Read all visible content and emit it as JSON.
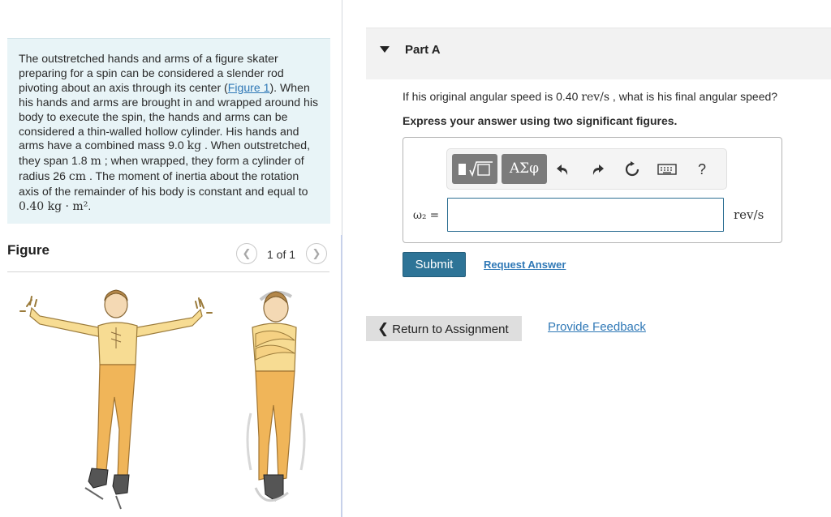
{
  "problem": {
    "text_before_link": "The outstretched hands and arms of a figure skater preparing for a spin can be considered a slender rod pivoting about an axis through its center (",
    "figure_link": "Figure 1",
    "text_after_link": "). When his hands and arms are brought in and wrapped around his body to execute the spin, the hands and arms can be considered a thin-walled hollow cylinder. His hands and arms have a combined mass 9.0 ",
    "mass_unit": "kg",
    "text_span": " . When outstretched, they span 1.8 ",
    "span_unit": "m",
    "text_radius": " ; when wrapped, they form a cylinder of radius 26 ",
    "radius_unit": "cm",
    "text_moment": " . The moment of inertia about the rotation axis of the remainder of his body is constant and equal to ",
    "moment_value": "0.40 kg · m²",
    "text_end": "."
  },
  "figure": {
    "title": "Figure",
    "pager": "1 of 1",
    "prev_icon": "chevron-left-icon",
    "next_icon": "chevron-right-icon"
  },
  "part": {
    "title": "Part A",
    "question_before": "If his original angular speed is 0.40 ",
    "question_unit": "rev/s",
    "question_after": " , what is his final angular speed?",
    "instruction": "Express your answer using two significant figures."
  },
  "answer": {
    "symbols_label": "ΑΣφ",
    "help_label": "?",
    "variable_label": "ω₂ =",
    "input_value": "",
    "unit": "rev/s",
    "toolbar_icons": [
      "templates-icon",
      "symbols-icon",
      "undo-icon",
      "redo-icon",
      "reset-icon",
      "keyboard-icon",
      "help-icon"
    ]
  },
  "actions": {
    "submit": "Submit",
    "request_answer": "Request Answer",
    "return": "Return to Assignment",
    "feedback": "Provide Feedback"
  },
  "colors": {
    "problem_bg": "#e8f4f7",
    "link": "#2f78b6",
    "submit_bg": "#2e7497",
    "skater_pants": "#f0b559",
    "skater_shirt": "#f6d37c"
  }
}
